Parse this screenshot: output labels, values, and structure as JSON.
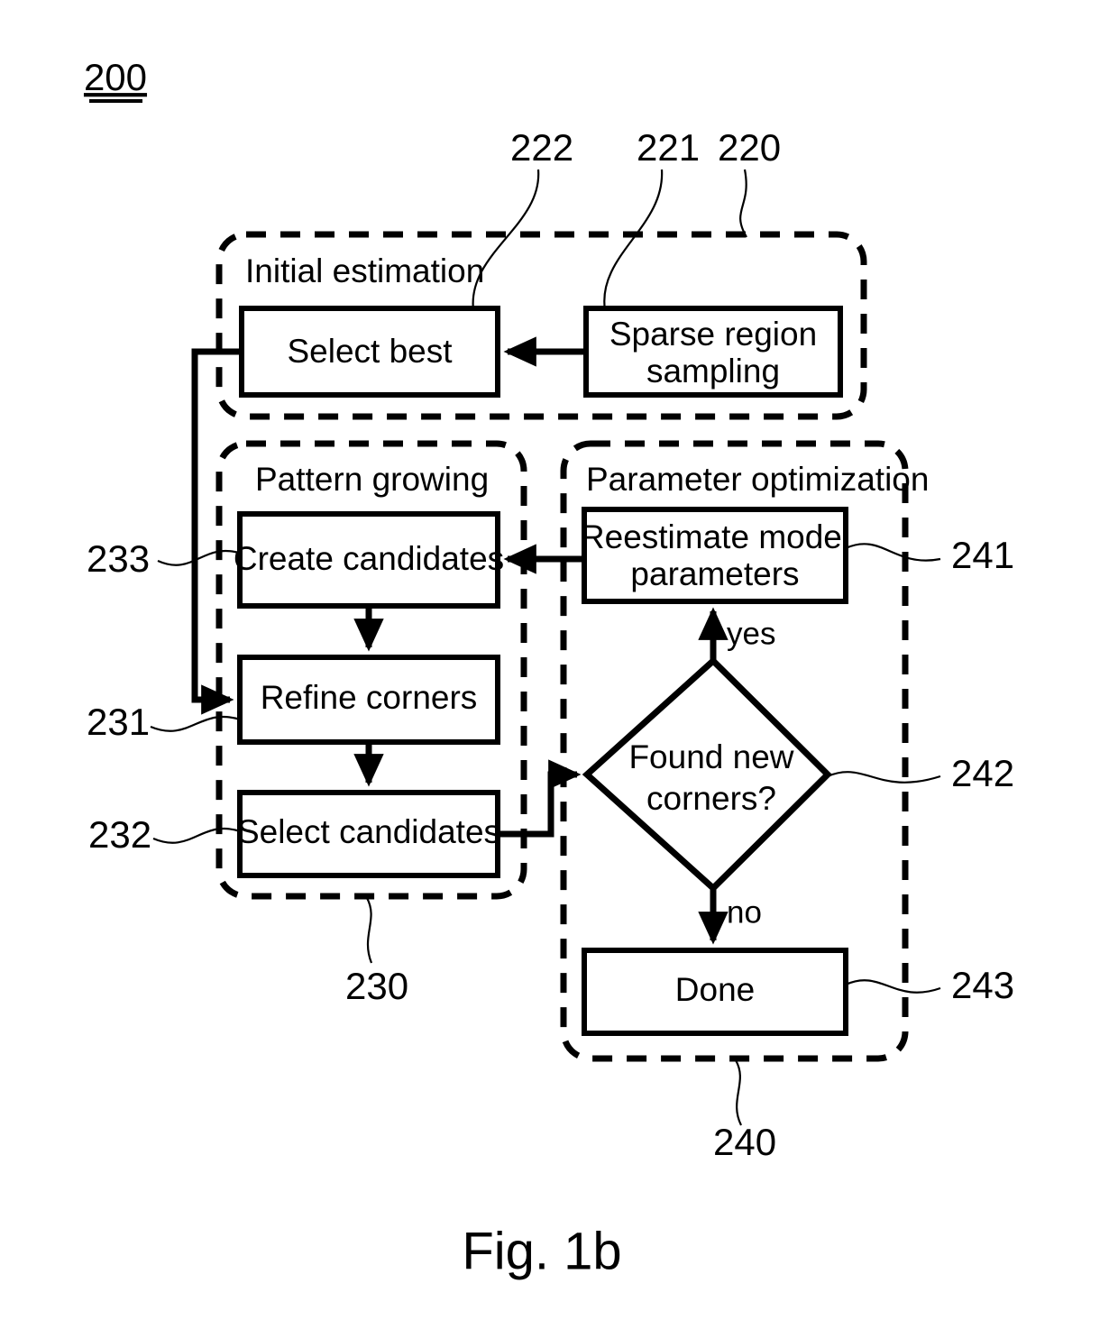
{
  "figure": {
    "id_label": "200",
    "caption": "Fig. 1b"
  },
  "groups": [
    {
      "key": "initial_estimation",
      "title": "Initial estimation",
      "ref": "220"
    },
    {
      "key": "pattern_growing",
      "title": "Pattern growing",
      "ref": "230"
    },
    {
      "key": "parameter_optimization",
      "title": "Parameter optimization",
      "ref": "240"
    }
  ],
  "nodes": {
    "select_best": {
      "label": "Select best",
      "ref": "222"
    },
    "sparse_region_sampling": {
      "line1": "Sparse region",
      "line2": "sampling",
      "ref": "221"
    },
    "create_candidates": {
      "label": "Create candidates",
      "ref": "233"
    },
    "refine_corners": {
      "label": "Refine corners",
      "ref": "231"
    },
    "select_candidates": {
      "label": "Select candidates",
      "ref": "232"
    },
    "reestimate_model_parameters": {
      "line1": "Reestimate model",
      "line2": "parameters",
      "ref": "241"
    },
    "found_new_corners": {
      "line1": "Found new",
      "line2": "corners?",
      "ref": "242"
    },
    "done": {
      "label": "Done",
      "ref": "243"
    }
  },
  "edge_labels": {
    "yes": "yes",
    "no": "no"
  },
  "colors": {
    "ink": "#000000",
    "paper": "#ffffff"
  }
}
